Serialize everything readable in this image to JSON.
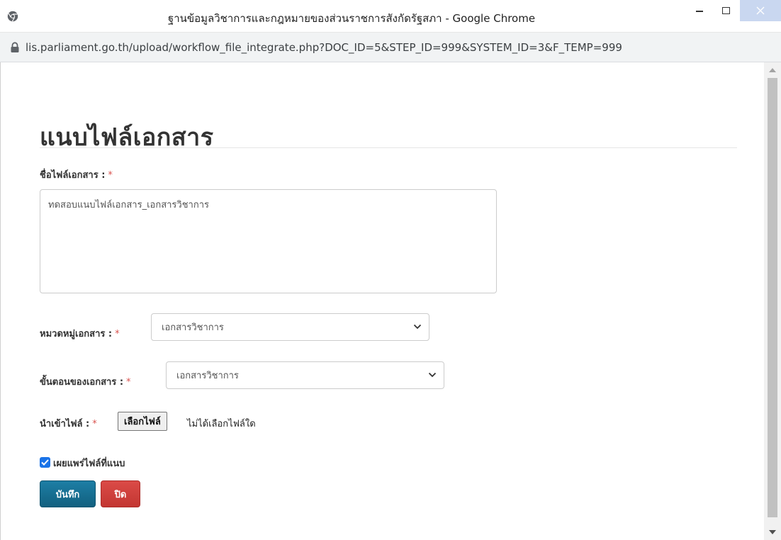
{
  "window": {
    "title": "ฐานข้อมูลวิชาการและกฎหมายของส่วนราชการสังกัดรัฐสภา - Google Chrome",
    "url": "lis.parliament.go.th/upload/workflow_file_integrate.php?DOC_ID=5&STEP_ID=999&SYSTEM_ID=3&F_TEMP=999"
  },
  "form": {
    "title": "แนบไฟล์เอกสาร",
    "required_mark": "*",
    "filename_label": "ชื่อไฟล์เอกสาร :",
    "filename_value": "ทดสอบแนบไฟล์เอกสาร_เอกสารวิชาการ",
    "category_label": "หมวดหมู่เอกสาร :",
    "category_value": "เอกสารวิชาการ",
    "step_label": "ขั้นตอนของเอกสาร :",
    "step_value": "เอกสารวิชาการ",
    "import_label": "นำเข้าไฟล์ :",
    "choose_file_label": "เลือกไฟล์",
    "no_file_text": "ไม่ได้เลือกไฟล์ใด",
    "publish_label": "เผยแพร่ไฟล์ที่แนบ",
    "publish_checked": true,
    "save_label": "บันทึก",
    "close_label": "ปิด"
  },
  "icons": {
    "chrome": "chrome-icon",
    "lock": "lock-icon",
    "minimize": "minimize-icon",
    "maximize": "maximize-icon",
    "close": "close-icon",
    "select_chevron": "chevron-down-icon",
    "checkmark": "check-icon"
  },
  "colors": {
    "save_button": "#16698d",
    "close_button": "#d43f3a",
    "required": "#d9534f",
    "checkbox": "#1a73e8"
  }
}
